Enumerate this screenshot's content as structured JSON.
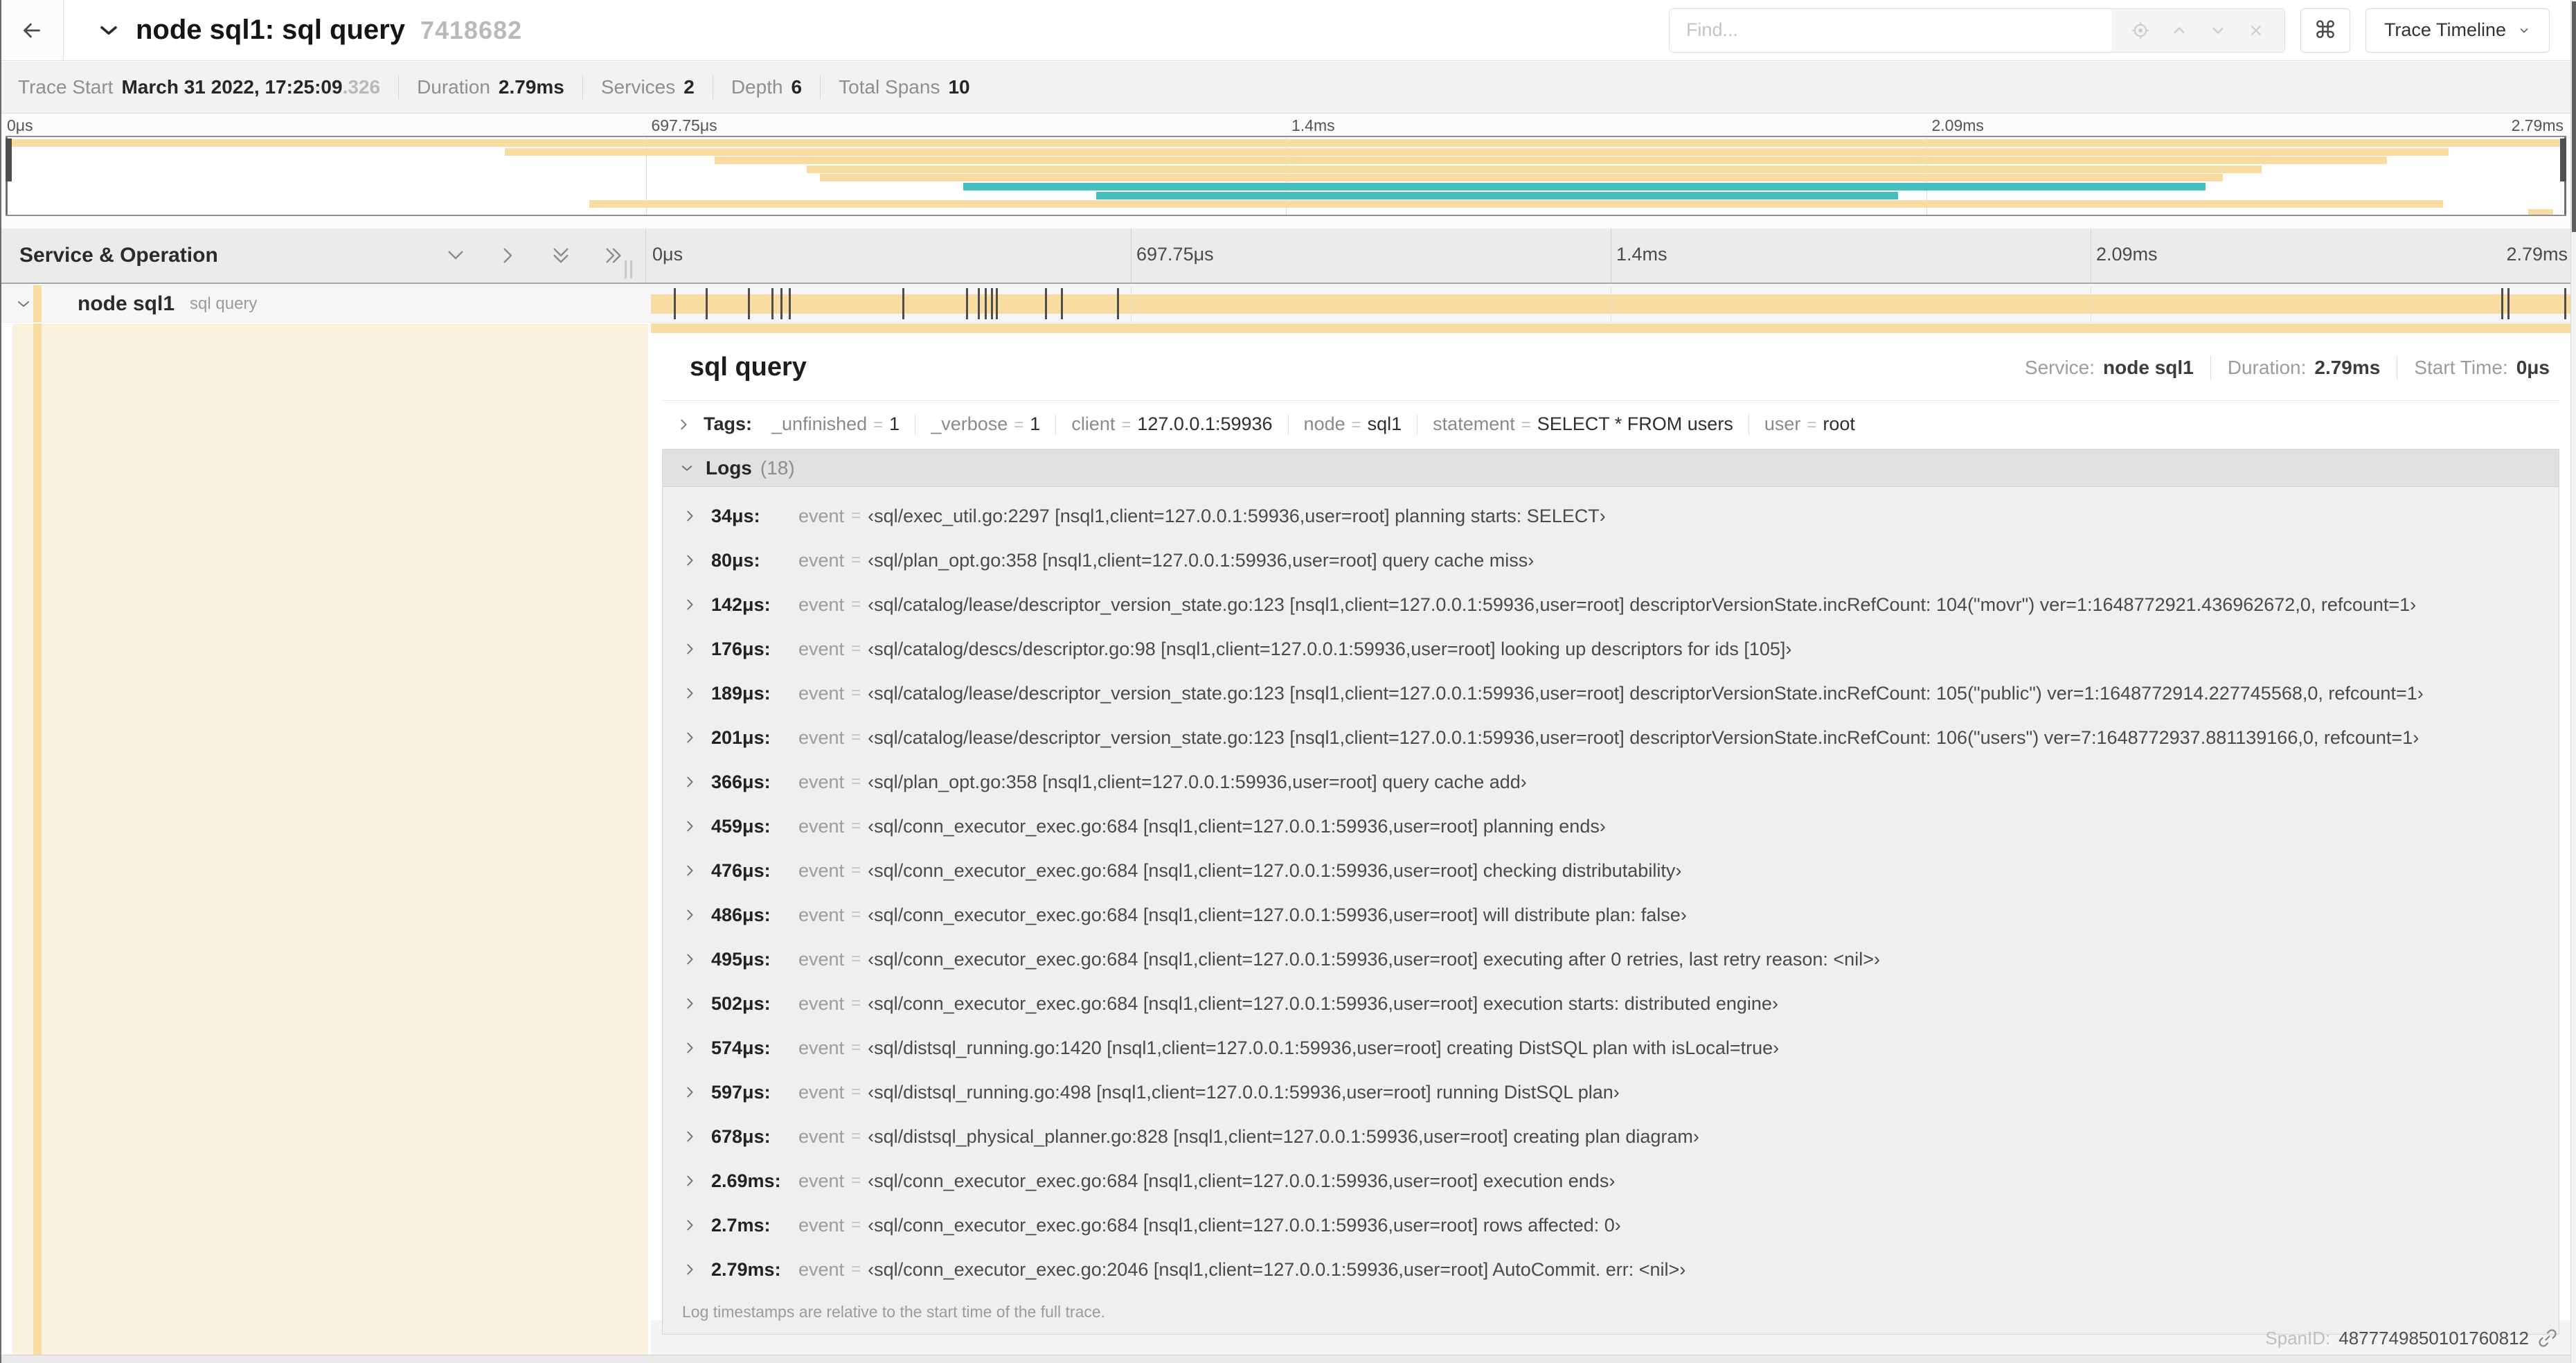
{
  "header": {
    "title": "node sql1: sql query",
    "trace_id": "7418682",
    "find_placeholder": "Find...",
    "shortcut_button": "⌘",
    "view_selector_label": "Trace Timeline"
  },
  "trace_info": {
    "items": [
      {
        "label": "Trace Start",
        "value": "March 31 2022, 17:25:09",
        "suffix": ".326"
      },
      {
        "label": "Duration",
        "value": "2.79ms",
        "suffix": ""
      },
      {
        "label": "Services",
        "value": "2",
        "suffix": ""
      },
      {
        "label": "Depth",
        "value": "6",
        "suffix": ""
      },
      {
        "label": "Total Spans",
        "value": "10",
        "suffix": ""
      }
    ]
  },
  "timeline": {
    "ticks": [
      "0μs",
      "697.75μs",
      "1.4ms",
      "2.09ms",
      "2.79ms"
    ],
    "tick_fractions": [
      0,
      0.25,
      0.5,
      0.75,
      1
    ],
    "grid_fractions": [
      0.25,
      0.5,
      0.75
    ]
  },
  "minimap": {
    "spans": [
      {
        "color": "tan",
        "start": 0,
        "end": 1
      },
      {
        "color": "tan",
        "start": 0.195,
        "end": 0.954
      },
      {
        "color": "tan",
        "start": 0.277,
        "end": 0.93
      },
      {
        "color": "tan",
        "start": 0.313,
        "end": 0.881
      },
      {
        "color": "tan",
        "start": 0.318,
        "end": 0.866
      },
      {
        "color": "teal",
        "start": 0.374,
        "end": 0.859
      },
      {
        "color": "teal",
        "start": 0.426,
        "end": 0.739
      },
      {
        "color": "tan",
        "start": 0.228,
        "end": 0.952
      },
      {
        "color": "tan",
        "start": 0.985,
        "end": 0.995
      }
    ]
  },
  "table_header": {
    "title": "Service & Operation"
  },
  "span_row": {
    "service": "node sql1",
    "operation": "sql query",
    "log_marker_fractions": [
      0.0122,
      0.0287,
      0.0509,
      0.0631,
      0.0678,
      0.072,
      0.1312,
      0.1645,
      0.1706,
      0.1742,
      0.1774,
      0.1799,
      0.2057,
      0.214,
      0.243,
      0.9642,
      0.9677,
      0.997
    ]
  },
  "detail": {
    "title": "sql query",
    "meta": [
      {
        "label": "Service:",
        "value": "node sql1"
      },
      {
        "label": "Duration:",
        "value": "2.79ms"
      },
      {
        "label": "Start Time:",
        "value": "0μs"
      }
    ],
    "tags_label": "Tags:",
    "kv_separator": "=",
    "tags": [
      {
        "key": "_unfinished",
        "value": "1"
      },
      {
        "key": "_verbose",
        "value": "1"
      },
      {
        "key": "client",
        "value": "127.0.0.1:59936"
      },
      {
        "key": "node",
        "value": "sql1"
      },
      {
        "key": "statement",
        "value": "SELECT * FROM users"
      },
      {
        "key": "user",
        "value": "root"
      }
    ],
    "logs_label": "Logs",
    "logs_count": "(18)",
    "log_key": "event",
    "logs": [
      {
        "time": "34μs:",
        "value": "‹sql/exec_util.go:2297 [nsql1,client=127.0.0.1:59936,user=root] planning starts: SELECT›"
      },
      {
        "time": "80μs:",
        "value": "‹sql/plan_opt.go:358 [nsql1,client=127.0.0.1:59936,user=root] query cache miss›"
      },
      {
        "time": "142μs:",
        "value": "‹sql/catalog/lease/descriptor_version_state.go:123 [nsql1,client=127.0.0.1:59936,user=root] descriptorVersionState.incRefCount: 104(\"movr\") ver=1:1648772921.436962672,0, refcount=1›"
      },
      {
        "time": "176μs:",
        "value": "‹sql/catalog/descs/descriptor.go:98 [nsql1,client=127.0.0.1:59936,user=root] looking up descriptors for ids [105]›"
      },
      {
        "time": "189μs:",
        "value": "‹sql/catalog/lease/descriptor_version_state.go:123 [nsql1,client=127.0.0.1:59936,user=root] descriptorVersionState.incRefCount: 105(\"public\") ver=1:1648772914.227745568,0, refcount=1›"
      },
      {
        "time": "201μs:",
        "value": "‹sql/catalog/lease/descriptor_version_state.go:123 [nsql1,client=127.0.0.1:59936,user=root] descriptorVersionState.incRefCount: 106(\"users\") ver=7:1648772937.881139166,0, refcount=1›"
      },
      {
        "time": "366μs:",
        "value": "‹sql/plan_opt.go:358 [nsql1,client=127.0.0.1:59936,user=root] query cache add›"
      },
      {
        "time": "459μs:",
        "value": "‹sql/conn_executor_exec.go:684 [nsql1,client=127.0.0.1:59936,user=root] planning ends›"
      },
      {
        "time": "476μs:",
        "value": "‹sql/conn_executor_exec.go:684 [nsql1,client=127.0.0.1:59936,user=root] checking distributability›"
      },
      {
        "time": "486μs:",
        "value": "‹sql/conn_executor_exec.go:684 [nsql1,client=127.0.0.1:59936,user=root] will distribute plan: false›"
      },
      {
        "time": "495μs:",
        "value": "‹sql/conn_executor_exec.go:684 [nsql1,client=127.0.0.1:59936,user=root] executing after 0 retries, last retry reason: <nil>›"
      },
      {
        "time": "502μs:",
        "value": "‹sql/conn_executor_exec.go:684 [nsql1,client=127.0.0.1:59936,user=root] execution starts: distributed engine›"
      },
      {
        "time": "574μs:",
        "value": "‹sql/distsql_running.go:1420 [nsql1,client=127.0.0.1:59936,user=root] creating DistSQL plan with isLocal=true›"
      },
      {
        "time": "597μs:",
        "value": "‹sql/distsql_running.go:498 [nsql1,client=127.0.0.1:59936,user=root] running DistSQL plan›"
      },
      {
        "time": "678μs:",
        "value": "‹sql/distsql_physical_planner.go:828 [nsql1,client=127.0.0.1:59936,user=root] creating plan diagram›"
      },
      {
        "time": "2.69ms:",
        "value": "‹sql/conn_executor_exec.go:684 [nsql1,client=127.0.0.1:59936,user=root] execution ends›"
      },
      {
        "time": "2.7ms:",
        "value": "‹sql/conn_executor_exec.go:684 [nsql1,client=127.0.0.1:59936,user=root] rows affected: 0›"
      },
      {
        "time": "2.79ms:",
        "value": "‹sql/conn_executor_exec.go:2046 [nsql1,client=127.0.0.1:59936,user=root] AutoCommit. err: <nil>›"
      }
    ],
    "footer": "Log timestamps are relative to the start time of the full trace.",
    "span_id_label": "SpanID:",
    "span_id": "4877749850101760812"
  },
  "colors": {
    "tan": "#F8DCA1",
    "teal": "#45BFBD",
    "tan_faint": "#FAF2DF"
  }
}
